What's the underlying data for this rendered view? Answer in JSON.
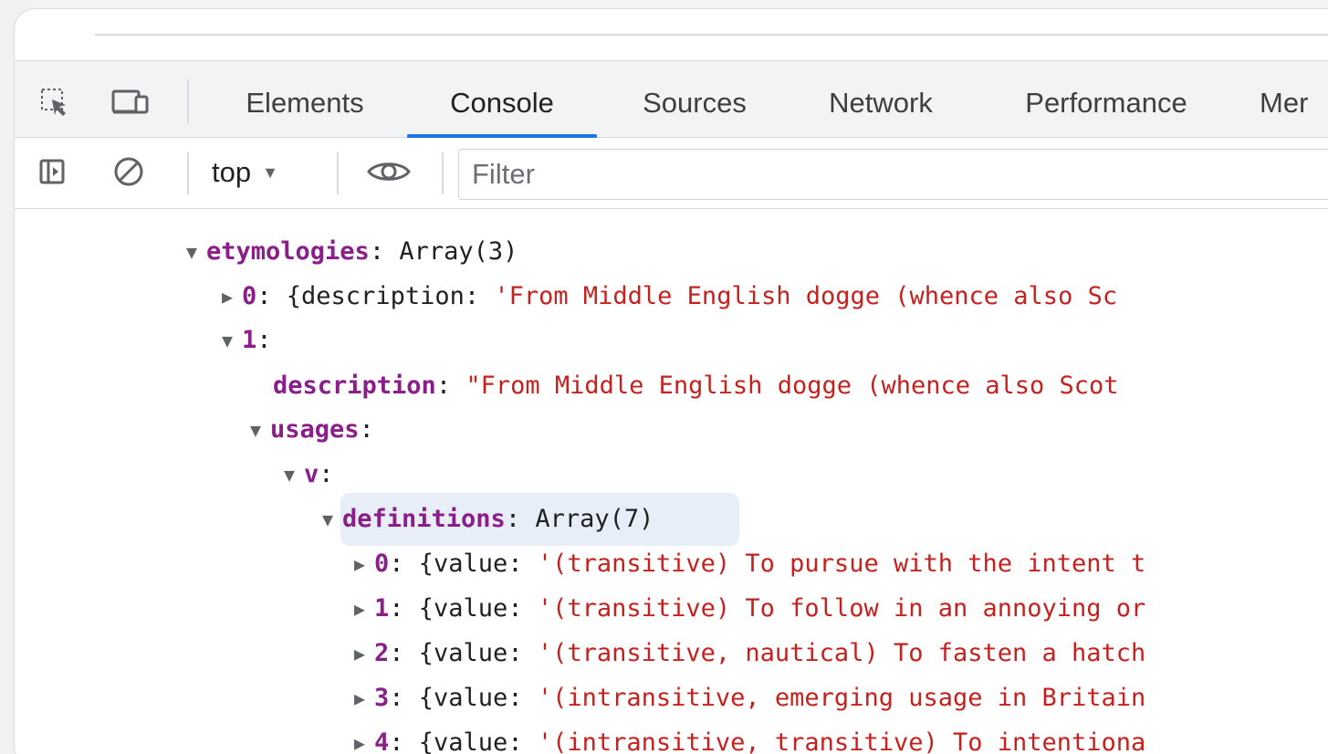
{
  "devtools": {
    "tabs": [
      {
        "label": "Elements"
      },
      {
        "label": "Console"
      },
      {
        "label": "Sources"
      },
      {
        "label": "Network"
      },
      {
        "label": "Performance"
      },
      {
        "label": "Mer"
      }
    ],
    "toolbar": {
      "context": "top",
      "filter_placeholder": "Filter"
    },
    "console": {
      "etymologies": {
        "key": "etymologies",
        "summary": "Array(3)"
      },
      "item0": {
        "index": "0",
        "prefix": "{description: ",
        "value": "'From Middle English dogge (whence also Sc"
      },
      "item1": {
        "index": "1"
      },
      "description": {
        "key": "description",
        "value": "\"From Middle English dogge (whence also Scot"
      },
      "usages": {
        "key": "usages"
      },
      "v": {
        "key": "v"
      },
      "definitions": {
        "key": "definitions",
        "summary": "Array(7)"
      },
      "definition_items": [
        {
          "index": "0",
          "prefix": "{value: ",
          "value": "'(transitive) To pursue with the intent t"
        },
        {
          "index": "1",
          "prefix": "{value: ",
          "value": "'(transitive) To follow in an annoying or"
        },
        {
          "index": "2",
          "prefix": "{value: ",
          "value": "'(transitive, nautical) To fasten a hatch"
        },
        {
          "index": "3",
          "prefix": "{value: ",
          "value": "'(intransitive, emerging usage in Britain"
        },
        {
          "index": "4",
          "prefix": "{value: ",
          "value": "'(intransitive, transitive) To intentiona"
        }
      ]
    },
    "colors": {
      "accent": "#1a73e8",
      "key": "#8a1f8a",
      "string": "#c5221f",
      "highlight": "#e8eef7"
    }
  }
}
